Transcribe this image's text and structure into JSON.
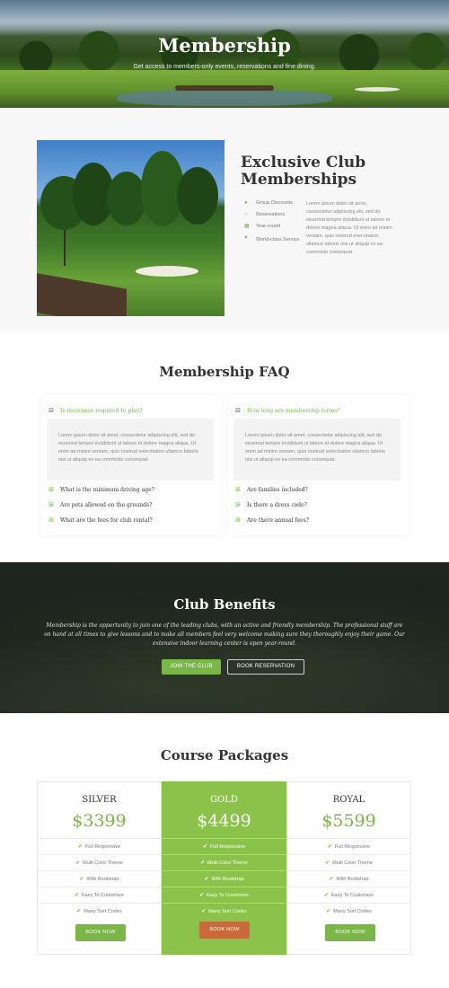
{
  "hero": {
    "title": "Membership",
    "subtitle": "Get access to members-only events, reservations and fine dining."
  },
  "club": {
    "title": "Exclusive Club Memberships",
    "features": [
      {
        "icon": "users-icon",
        "label": "Group Discounts"
      },
      {
        "icon": "clock-icon",
        "label": "Reservations"
      },
      {
        "icon": "calendar-icon",
        "label": "Year-round"
      },
      {
        "icon": "heart-icon",
        "label": "World-class Service"
      }
    ],
    "text": "Lorem ipsum dolor sit amet, consectetur adipiscing elit, sed do eiusmod tempor incididunt ut labore et dolore magna aliqua. Ut enim ad minim veniam, quis nostrud exercitation ullamco laboris nisi ut aliquip ex ea commodo consequat."
  },
  "faq": {
    "title": "Membership FAQ",
    "left": {
      "active_question": "Is insurance required to play?",
      "answer": "Lorem ipsum dolor sit amet, consectetur adipiscing elit, sed do eiusmod tempor incididunt ut labore et dolore magna aliqua. Ut enim ad minim veniam, quis nostrud exercitation ullamco laboris nisi ut aliquip ex ea commodo consequat.",
      "questions": [
        "What is the minimum driving age?",
        "Are pets allowed on the grounds?",
        "What are the fees for club rental?"
      ]
    },
    "right": {
      "active_question": "How long are membership terms?",
      "answer": "Lorem ipsum dolor sit amet, consectetur adipiscing elit, sed do eiusmod tempor incididunt ut labore et dolore magna aliqua. Ut enim ad minim veniam, quis nostrud exercitation ullamco laboris nisi ut aliquip ex ea commodo consequat.",
      "questions": [
        "Are families included?",
        "Is there a dress code?",
        "Are there annual fees?"
      ]
    }
  },
  "benefits": {
    "title": "Club Benefits",
    "text": "Membership is the opportunity to join one of the leading clubs, with an active and friendly membership. The professional staff are on hand at all times to give lessons and to make all members feel very welcome making sure they thoroughly enjoy their game. Our extensive indoor learning center is open year-round.",
    "join_label": "JOIN THE CLUB",
    "reserve_label": "BOOK RESERVATION"
  },
  "packages": {
    "title": "Course Packages",
    "items": [
      {
        "name": "SILVER",
        "price": "$3399",
        "button": "BOOK NOW",
        "features": [
          "Full Responsive",
          "Multi Color Theme",
          "With Bootstrap",
          "Easy To Customize",
          "Many Sort Codes"
        ]
      },
      {
        "name": "GOLD",
        "price": "$4499",
        "button": "BOOK NOW",
        "features": [
          "Full Responsive",
          "Multi Color Theme",
          "With Bootstrap",
          "Easy To Customize",
          "Many Sort Codes"
        ]
      },
      {
        "name": "ROYAL",
        "price": "$5599",
        "button": "BOOK NOW",
        "features": [
          "Full Responsive",
          "Multi Color Theme",
          "With Bootstrap",
          "Easy To Customize",
          "Many Sort Codes"
        ]
      }
    ]
  },
  "colors": {
    "accent": "#7ab648",
    "gold_bg": "#8bc34a",
    "gold_button": "#c86a3a",
    "dark_section": "#1f2620"
  }
}
